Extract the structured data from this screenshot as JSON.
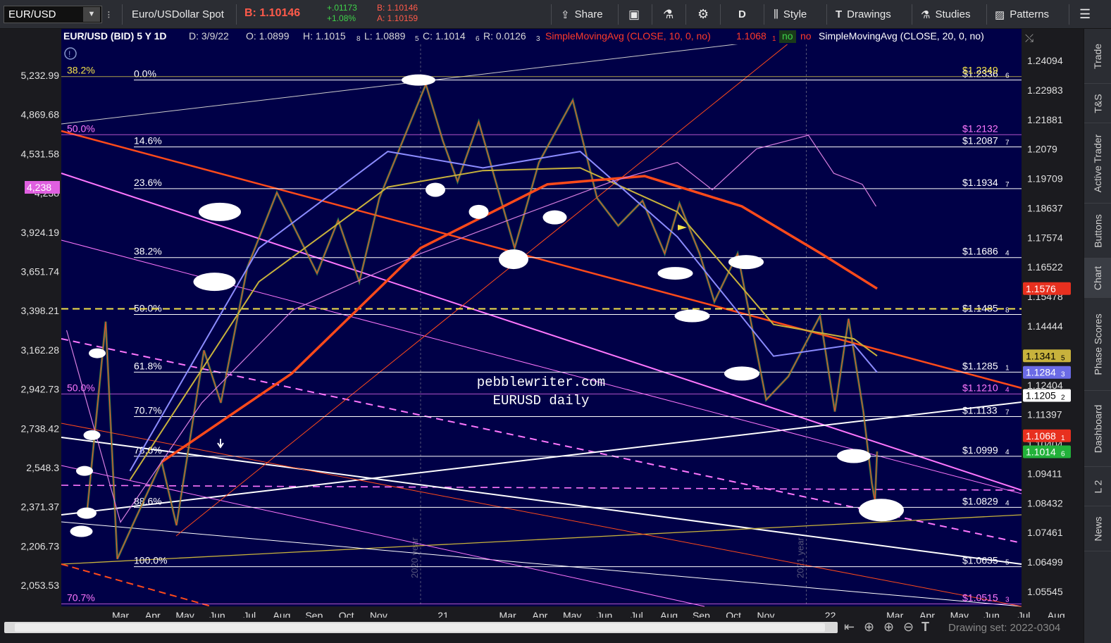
{
  "toolbar": {
    "symbol": "EUR/USD",
    "description": "Euro/USDollar Spot",
    "bid_label": "B: 1.10146",
    "change": "+.01173",
    "change_pct": "+1.08%",
    "bid_small": "B: 1.10146",
    "ask_small": "A: 1.10159",
    "share": "Share",
    "period": "D",
    "style": "Style",
    "drawings": "Drawings",
    "studies": "Studies",
    "patterns": "Patterns"
  },
  "legend": {
    "title": "EUR/USD (BID) 5 Y 1D",
    "date": "D: 3/9/22",
    "open": "O: 1.0899",
    "high": "H: 1.1015",
    "high_sub": "8",
    "low": "L: 1.0889",
    "low_sub": "5",
    "close": "C: 1.1014",
    "close_sub": "6",
    "range": "R: 0.0126",
    "range_sub": "3",
    "sma10": "SimpleMovingAvg (CLOSE, 10, 0, no)",
    "sma10_val": "1.1068",
    "sma10_sub": "1",
    "no1": "no",
    "no2": "no",
    "sma20": "SimpleMovingAvg (CLOSE, 20, 0, no)"
  },
  "chart_data": {
    "type": "line",
    "title": "EUR/USD (BID) 5 Y 1D",
    "watermark": [
      "pebblewriter.com",
      "EURUSD daily"
    ],
    "x_tick_labels": [
      "Mar",
      "Apr",
      "May",
      "Jun",
      "Jul",
      "Aug",
      "Sep",
      "Oct",
      "Nov",
      "21",
      "Mar",
      "Apr",
      "May",
      "Jun",
      "Jul",
      "Aug",
      "Sep",
      "Oct",
      "Nov",
      "22",
      "Mar",
      "Apr",
      "May",
      "Jun",
      "Jul",
      "Aug"
    ],
    "x_tick_positions_month_index": [
      0,
      1,
      2,
      3,
      4,
      5,
      6,
      7,
      8,
      10,
      12,
      13,
      14,
      15,
      16,
      17,
      18,
      19,
      20,
      22,
      24,
      25,
      26,
      27,
      28,
      29
    ],
    "year_markers": [
      "2020 year",
      "2021 year"
    ],
    "y_right_ticks": [
      "1.24094",
      "1.22983",
      "1.21881",
      "1.2079",
      "1.19709",
      "1.18637",
      "1.17574",
      "1.16522",
      "1.15478",
      "1.14444",
      "1.13418",
      "1.12404",
      "1.11397",
      "1.10404",
      "1.09411",
      "1.08432",
      "1.07461",
      "1.06499",
      "1.05545"
    ],
    "y_right_values": [
      1.24094,
      1.22983,
      1.21881,
      1.2079,
      1.19709,
      1.18637,
      1.17574,
      1.16522,
      1.15478,
      1.14444,
      1.13418,
      1.12404,
      1.11397,
      1.10404,
      1.09411,
      1.08432,
      1.07461,
      1.06499,
      1.05545
    ],
    "y_left_ticks": [
      "5,232.99",
      "4,869.68",
      "4,531.58",
      "4,238",
      "3,924.19",
      "3,651.74",
      "3,398.21",
      "3,162.28",
      "2,942.73",
      "2,738.42",
      "2,548.3",
      "2,371.37",
      "2,206.73",
      "2,053.53"
    ],
    "ylim": [
      1.051,
      1.246
    ],
    "log_scale": true,
    "grid": false,
    "series": [
      {
        "name": "EUR/USD close",
        "color": "#ffffff",
        "x": [
          "2020-02-20",
          "2020-03-09",
          "2020-03-20",
          "2020-04-06",
          "2020-05-01",
          "2020-05-15",
          "2020-06-10",
          "2020-06-26",
          "2020-07-21",
          "2020-08-18",
          "2020-09-25",
          "2020-10-15",
          "2020-11-04",
          "2020-11-23",
          "2021-01-06",
          "2021-01-22",
          "2021-02-05",
          "2021-02-25",
          "2021-03-31",
          "2021-04-23",
          "2021-05-25",
          "2021-06-17",
          "2021-07-07",
          "2021-07-30",
          "2021-08-20",
          "2021-09-03",
          "2021-09-22",
          "2021-10-06",
          "2021-10-28",
          "2021-11-24",
          "2021-12-15",
          "2022-01-14",
          "2022-01-28",
          "2022-02-10",
          "2022-02-24",
          "2022-03-04",
          "2022-03-07",
          "2022-03-09"
        ],
        "values": [
          1.08,
          1.146,
          1.066,
          1.079,
          1.098,
          1.077,
          1.136,
          1.118,
          1.165,
          1.192,
          1.163,
          1.182,
          1.16,
          1.19,
          1.232,
          1.211,
          1.196,
          1.218,
          1.172,
          1.203,
          1.226,
          1.19,
          1.18,
          1.189,
          1.17,
          1.188,
          1.17,
          1.153,
          1.17,
          1.119,
          1.127,
          1.148,
          1.115,
          1.147,
          1.115,
          1.091,
          1.085,
          1.1015
        ]
      },
      {
        "name": "SMA 10",
        "color": "#ff4a3a",
        "x": [
          "2022-02-20",
          "2022-03-01",
          "2022-03-09"
        ],
        "values": [
          1.135,
          1.118,
          1.1068
        ]
      },
      {
        "name": "SMA 20",
        "color": "#ffffff",
        "x": [
          "2022-02-20",
          "2022-03-09"
        ],
        "values": [
          1.14,
          1.1205
        ]
      },
      {
        "name": "SMA 50",
        "color": "#8c8cff",
        "values_last": 1.1284
      },
      {
        "name": "SMA 100",
        "color": "#c8b23c",
        "values_last": 1.1341
      },
      {
        "name": "SMA 200",
        "color": "#ff4a1a",
        "values_last": 1.1576
      },
      {
        "name": "SPX overlay",
        "color": "#d77ee0",
        "values_last": 4238
      }
    ],
    "fib_levels": [
      {
        "label": "0.0%",
        "price": "$1.2336",
        "value": 1.2336
      },
      {
        "label": "14.6%",
        "price": "$1.2087",
        "value": 1.2087
      },
      {
        "label": "23.6%",
        "price": "$1.1934",
        "value": 1.1934
      },
      {
        "label": "38.2%",
        "price": "$1.1686",
        "value": 1.1686
      },
      {
        "label": "50.0%",
        "price": "$1.1485",
        "value": 1.1485
      },
      {
        "label": "61.8%",
        "price": "$1.1285",
        "value": 1.1285
      },
      {
        "label": "70.7%",
        "price": "$1.1133",
        "value": 1.1133
      },
      {
        "label": "78.6%",
        "price": "$1.0999",
        "value": 1.0999
      },
      {
        "label": "88.6%",
        "price": "$1.0829",
        "value": 1.0829
      },
      {
        "label": "100.0%",
        "price": "$1.0635",
        "value": 1.0635
      }
    ],
    "fib_price_subs": [
      "6",
      "7",
      "7",
      "4",
      "8",
      "1",
      "7",
      "4",
      "4",
      "5"
    ],
    "pink_fib_levels": [
      {
        "label": "38.2%",
        "price": "$1.2349",
        "value": 1.2349
      },
      {
        "label": "50.0%",
        "price": "$1.2132",
        "value": 1.2132
      },
      {
        "label": "50.0%",
        "price": "$1.1210",
        "value": 1.121
      },
      {
        "label": "70.7%",
        "price": "$1.0515",
        "value": 1.0515
      }
    ],
    "pink_fib_price_subs": [
      "",
      "",
      "4",
      "3"
    ],
    "price_tags": [
      {
        "text": "1.1576",
        "value": 1.1576,
        "bg": "#e8301f",
        "fg": "#ffffff"
      },
      {
        "text": "1.1341",
        "sub": "5",
        "value": 1.1341,
        "bg": "#c8b23c",
        "fg": "#000000"
      },
      {
        "text": "1.1284",
        "sub": "3",
        "value": 1.1284,
        "bg": "#6b6be6",
        "fg": "#ffffff"
      },
      {
        "text": "1.1205",
        "sub": "2",
        "value": 1.1205,
        "bg": "#ffffff",
        "fg": "#000000"
      },
      {
        "text": "1.1068",
        "sub": "1",
        "value": 1.1068,
        "bg": "#e8301f",
        "fg": "#ffffff"
      },
      {
        "text": "1.1014",
        "sub": "6",
        "value": 1.1014,
        "bg": "#22b23a",
        "fg": "#ffffff"
      }
    ],
    "left_tag": "4,238"
  },
  "rightbar": [
    "Trade",
    "T&S",
    "Active Trader",
    "Buttons",
    "Chart",
    "Phase Scores",
    "Dashboard",
    "L 2",
    "News"
  ],
  "bottom": {
    "drawing_set": "Drawing set: 2022-0304"
  },
  "colors": {
    "plot_bg": "#000047",
    "fib_white": "#ffffff",
    "fib_pink": "#ff77ff",
    "fib_yellow": "#f5e34a"
  }
}
